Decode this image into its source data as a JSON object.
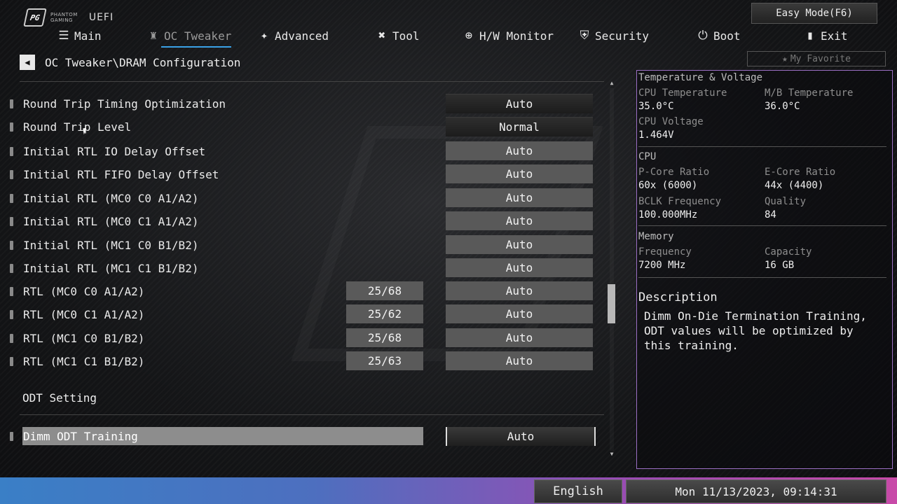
{
  "logo": {
    "line1": "PHANTOM",
    "line2": "GAMING",
    "uefi": "UEFI",
    "badge": "PG"
  },
  "easy_mode": "Easy Mode(F6)",
  "nav": [
    {
      "id": "main",
      "label": "Main",
      "icon": "list-icon"
    },
    {
      "id": "oc-tweaker",
      "label": "OC Tweaker",
      "icon": "rocket-icon"
    },
    {
      "id": "advanced",
      "label": "Advanced",
      "icon": "star-icon"
    },
    {
      "id": "tool",
      "label": "Tool",
      "icon": "tools-icon"
    },
    {
      "id": "hw-monitor",
      "label": "H/W Monitor",
      "icon": "crosshair-icon"
    },
    {
      "id": "security",
      "label": "Security",
      "icon": "shield-icon"
    },
    {
      "id": "boot",
      "label": "Boot",
      "icon": "power-icon"
    },
    {
      "id": "exit",
      "label": "Exit",
      "icon": "exit-door-icon"
    }
  ],
  "favorite": "My Favorite",
  "breadcrumb": "OC Tweaker\\DRAM Configuration",
  "settings": [
    {
      "label": "Round Trip Timing Optimization",
      "current": "",
      "value": "Auto",
      "style": "dark"
    },
    {
      "label": "Round Trip Level",
      "current": "",
      "value": "Normal",
      "style": "dark"
    },
    {
      "label": "Initial RTL IO Delay Offset",
      "current": "",
      "value": "Auto",
      "style": "grey"
    },
    {
      "label": "Initial RTL FIFO Delay Offset",
      "current": "",
      "value": "Auto",
      "style": "grey"
    },
    {
      "label": "Initial RTL (MC0 C0 A1/A2)",
      "current": "",
      "value": "Auto",
      "style": "grey"
    },
    {
      "label": "Initial RTL (MC0 C1 A1/A2)",
      "current": "",
      "value": "Auto",
      "style": "grey"
    },
    {
      "label": "Initial RTL (MC1 C0 B1/B2)",
      "current": "",
      "value": "Auto",
      "style": "grey"
    },
    {
      "label": "Initial RTL (MC1 C1 B1/B2)",
      "current": "",
      "value": "Auto",
      "style": "grey"
    },
    {
      "label": "RTL (MC0 C0 A1/A2)",
      "current": "25/68",
      "value": "Auto",
      "style": "grey"
    },
    {
      "label": "RTL (MC0 C1 A1/A2)",
      "current": "25/62",
      "value": "Auto",
      "style": "grey"
    },
    {
      "label": "RTL (MC1 C0 B1/B2)",
      "current": "25/68",
      "value": "Auto",
      "style": "grey"
    },
    {
      "label": "RTL (MC1 C1 B1/B2)",
      "current": "25/63",
      "value": "Auto",
      "style": "grey"
    }
  ],
  "odt_section": "ODT Setting",
  "selected_setting": {
    "label": "Dimm ODT Training",
    "value": "Auto"
  },
  "panel": {
    "temp_voltage": {
      "title": "Temperature & Voltage",
      "cpu_temp_label": "CPU Temperature",
      "cpu_temp": "35.0°C",
      "mb_temp_label": "M/B Temperature",
      "mb_temp": "36.0°C",
      "cpu_volt_label": "CPU Voltage",
      "cpu_volt": "1.464V"
    },
    "cpu": {
      "title": "CPU",
      "pcore_label": "P-Core Ratio",
      "pcore": "60x (6000)",
      "ecore_label": "E-Core Ratio",
      "ecore": "44x (4400)",
      "bclk_label": "BCLK Frequency",
      "bclk": "100.000MHz",
      "quality_label": "Quality",
      "quality": "84"
    },
    "memory": {
      "title": "Memory",
      "freq_label": "Frequency",
      "freq": "7200 MHz",
      "cap_label": "Capacity",
      "cap": "16 GB"
    },
    "description": {
      "title": "Description",
      "text": "Dimm On-Die Termination Training, ODT values will be optimized by this training."
    }
  },
  "footer": {
    "language": "English",
    "datetime": "Mon 11/13/2023, 09:14:31"
  },
  "colors": {
    "accent": "#3aa1e6",
    "panel_border": "#9b6fc4",
    "footer_start": "#3a7fc6",
    "footer_end": "#c84aa8"
  }
}
